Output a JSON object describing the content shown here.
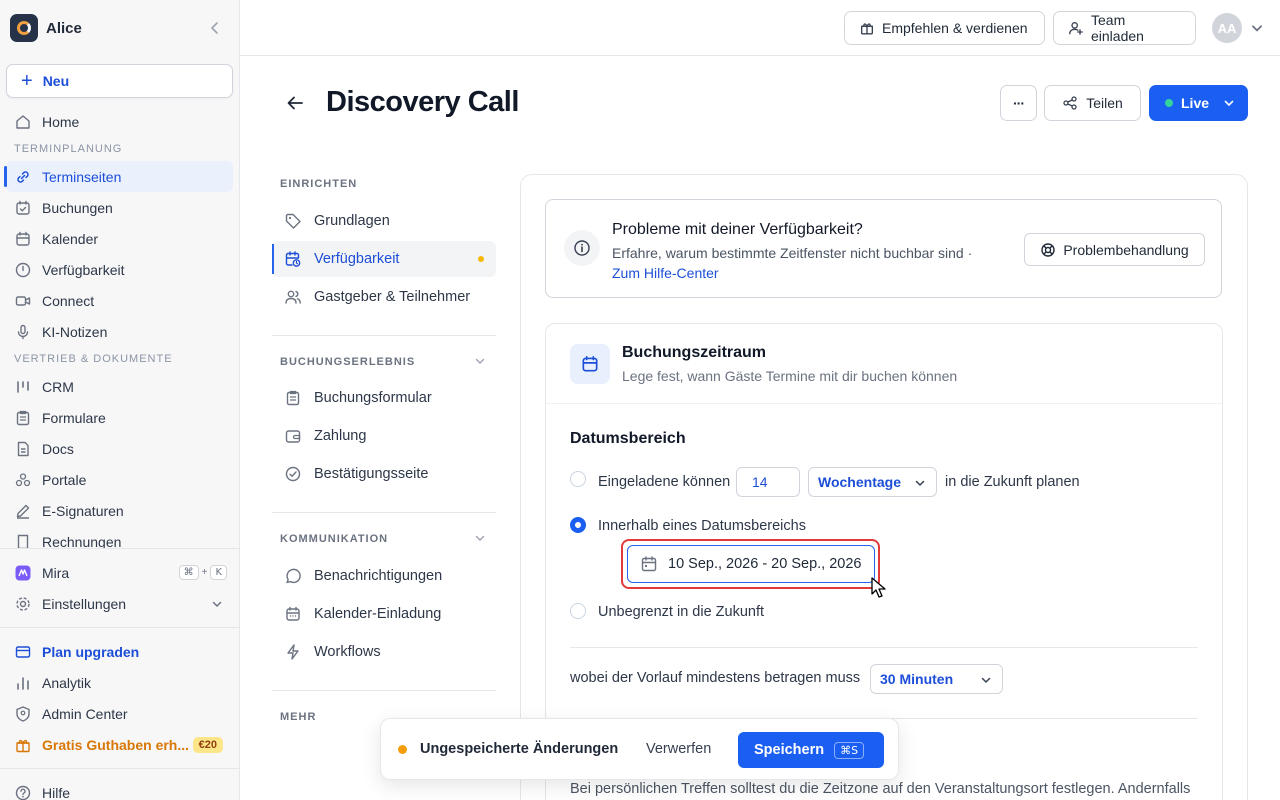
{
  "sidebar": {
    "workspace": "Alice",
    "new_label": "Neu",
    "home": "Home",
    "section1": "TERMINPLANUNG",
    "items1": [
      "Terminseiten",
      "Buchungen",
      "Kalender",
      "Verfügbarkeit",
      "Connect",
      "KI-Notizen"
    ],
    "section2": "VERTRIEB & DOKUMENTE",
    "items2": [
      "CRM",
      "Formulare",
      "Docs",
      "Portale",
      "E-Signaturen",
      "Rechnungen"
    ],
    "mira": "Mira",
    "mira_shortcut": [
      "⌘",
      "+",
      "K"
    ],
    "settings": "Einstellungen",
    "upgrade": "Plan upgraden",
    "analytics": "Analytik",
    "admin": "Admin Center",
    "credit": "Gratis Guthaben erh...",
    "credit_badge": "€20",
    "help": "Hilfe"
  },
  "topbar": {
    "refer": "Empfehlen & verdienen",
    "invite": "Team einladen",
    "avatar": "AA"
  },
  "header": {
    "title": "Discovery Call",
    "more": "···",
    "share": "Teilen",
    "status": "Live"
  },
  "settings_nav": {
    "setup_title": "EINRICHTEN",
    "setup": [
      "Grundlagen",
      "Verfügbarkeit",
      "Gastgeber & Teilnehmer"
    ],
    "booking_title": "BUCHUNGSERLEBNIS",
    "booking": [
      "Buchungsformular",
      "Zahlung",
      "Bestätigungsseite"
    ],
    "comm_title": "KOMMUNIKATION",
    "comm": [
      "Benachrichtigungen",
      "Kalender-Einladung",
      "Workflows"
    ],
    "more_title": "MEHR"
  },
  "alert": {
    "title": "Probleme mit deiner Verfügbarkeit?",
    "desc": "Erfahre, warum bestimmte Zeitfenster nicht buchbar sind ·",
    "link": "Zum Hilfe-Center",
    "button": "Problembehandlung"
  },
  "booking_window": {
    "title": "Buchungszeitraum",
    "subtitle": "Lege fest, wann Gäste Termine mit dir buchen können",
    "date_range_heading": "Datumsbereich",
    "opt1_prefix": "Eingeladene können",
    "opt1_value": "14",
    "opt1_unit": "Wochentage",
    "opt1_suffix": "in die Zukunft planen",
    "opt2_label": "Innerhalb eines Datumsbereichs",
    "opt2_range": "10 Sep., 2026 - 20 Sep., 2026",
    "opt3_label": "Unbegrenzt in die Zukunft",
    "selected_option": 2,
    "lead_label": "wobei der Vorlauf mindestens betragen muss",
    "lead_value": "30 Minuten",
    "timezone_text": "Bei persönlichen Treffen solltest du die Zeitzone auf den Veranstaltungsort festlegen. Andernfalls"
  },
  "unsaved_bar": {
    "text": "Ungespeicherte Änderungen",
    "discard": "Verwerfen",
    "save": "Speichern",
    "save_shortcut": "⌘S"
  }
}
